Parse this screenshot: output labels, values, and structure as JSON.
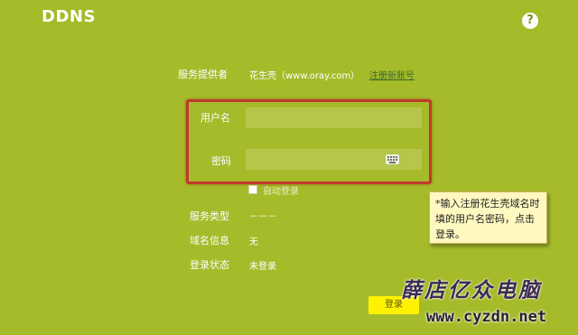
{
  "page": {
    "title": "DDNS",
    "help_icon": "help-icon",
    "help_glyph": "?"
  },
  "form": {
    "provider_label": "服务提供者",
    "provider_value": "花生壳（www.oray.com）",
    "register_link": "注册新账号",
    "username_label": "用户名",
    "username_value": "",
    "password_label": "密码",
    "password_value": "",
    "keyboard_icon": "keyboard-icon",
    "auto_login_label": "自动登录",
    "auto_login_checked": false,
    "service_type_label": "服务类型",
    "service_type_value": "－－－",
    "domain_info_label": "域名信息",
    "domain_info_value": "无",
    "login_status_label": "登录状态",
    "login_status_value": "未登录",
    "login_button": "登录"
  },
  "annotation": {
    "note_text": "*输入注册花生壳域名时填的用户名密码，点击登录。",
    "highlight_color": "#c0392b"
  },
  "watermark": {
    "text": "薛店亿众电脑",
    "url": "www.cyzdn.net"
  },
  "colors": {
    "background": "#a6bb2a",
    "field": "#b6c64a",
    "button": "#fff200"
  }
}
